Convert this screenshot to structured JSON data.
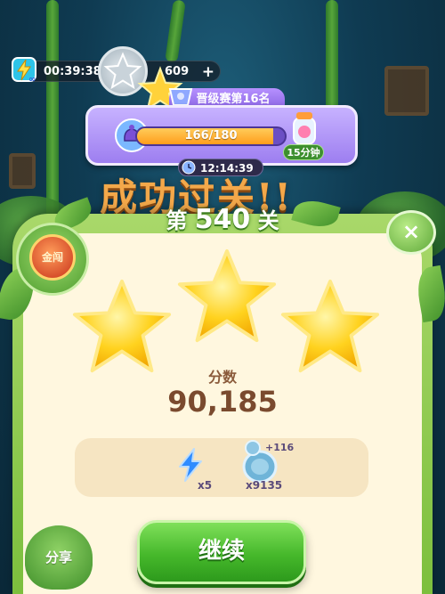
{
  "topbar": {
    "timer": "00:39:38",
    "coins": "609",
    "coin_add": "+"
  },
  "league": {
    "title": "晋级赛第16名",
    "progress_text": "166/180",
    "progress_fraction": 0.922,
    "timer": "12:14:39",
    "bottle_label": "15分钟"
  },
  "banner": {
    "text": "成功过关!!"
  },
  "level": {
    "prefix": "第",
    "number": "540",
    "suffix": "关",
    "stars_earned": 3,
    "stars_total": 3
  },
  "badge": {
    "label": "金闯"
  },
  "close_label": "×",
  "score": {
    "label": "分数",
    "value": "90,185"
  },
  "rewards": [
    {
      "icon": "lightning-icon",
      "count": "x5"
    },
    {
      "icon": "coin-icon",
      "count": "x9135",
      "bonus": "+116"
    }
  ],
  "buttons": {
    "share": "分享",
    "continue": "继续"
  },
  "colors": {
    "accent_green": "#46b82b",
    "league_purple": "#9d7ef0",
    "progress_orange": "#ff9d1c",
    "card_cream": "#fff7df",
    "score_brown": "#7a4a2e"
  }
}
